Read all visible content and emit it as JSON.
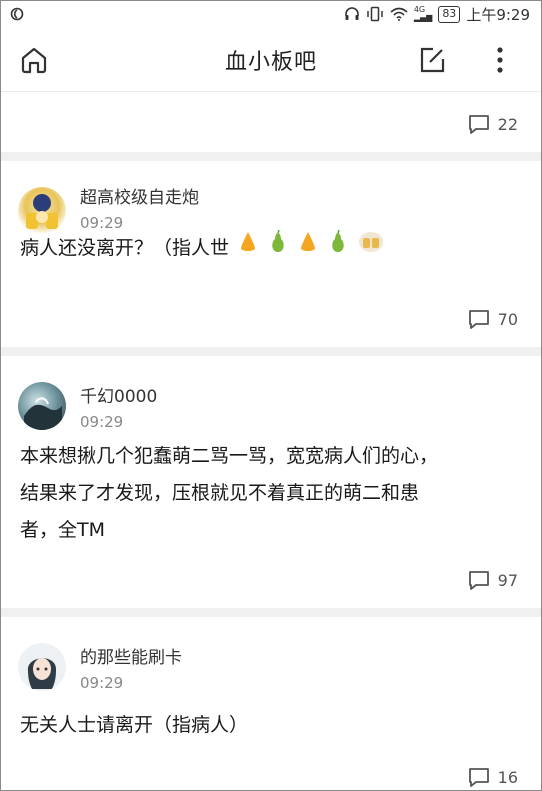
{
  "status_bar": {
    "time_prefix": "上午9:29",
    "battery": "83",
    "network": "4G"
  },
  "header": {
    "title": "血小板吧"
  },
  "top_card": {
    "comment_count": "22"
  },
  "posts": [
    {
      "username": "超高校级自走炮",
      "time": "09:29",
      "text": "病人还没离开？（指人世",
      "comment_count": "70"
    },
    {
      "username": "千幻0000",
      "time": "09:29",
      "text_line1": "本来想揪几个犯蠢萌二骂一骂，宽宽病人们的心，",
      "text_line2": "结果来了才发现，压根就见不着真正的萌二和患",
      "text_line3": "者，全TM",
      "comment_count": "97"
    },
    {
      "username": "的那些能刷卡",
      "time": "09:29",
      "text": "无关人士请离开（指病人）",
      "comment_count": "16"
    }
  ]
}
